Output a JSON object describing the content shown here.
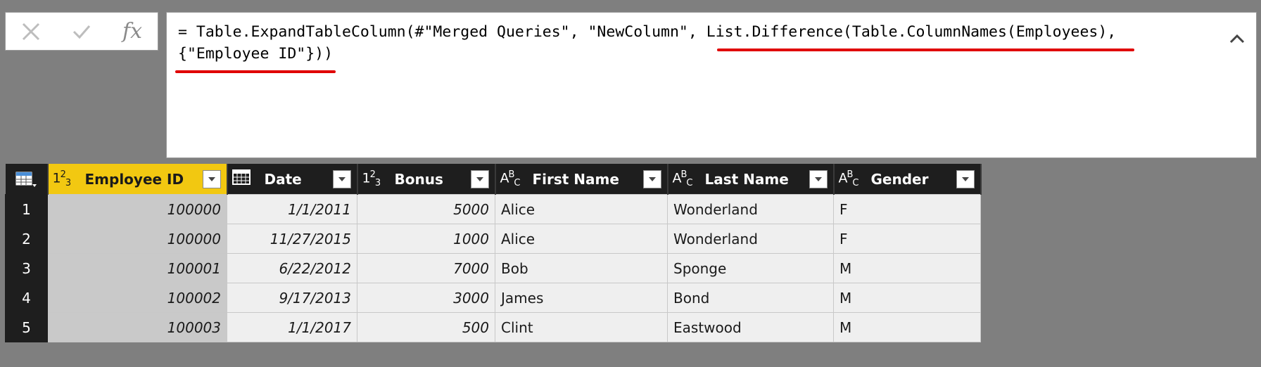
{
  "formula_bar": {
    "cancel_icon": "close-icon",
    "commit_icon": "check-icon",
    "fx_label": "fx",
    "formula_part1": "= Table.ExpandTableColumn(#\"Merged Queries\", \"NewColumn\", ",
    "formula_highlight1": "List.Difference(Table.ColumnNames(Employees),",
    "formula_space": " ",
    "formula_highlight2": "{\"Employee ID\"})",
    "formula_end": ")",
    "underline_color": "#e00000"
  },
  "table": {
    "columns": [
      {
        "type_icon": "123",
        "label": "Employee ID",
        "active": true
      },
      {
        "type_icon": "date",
        "label": "Date"
      },
      {
        "type_icon": "123",
        "label": "Bonus"
      },
      {
        "type_icon": "ABC",
        "label": "First Name"
      },
      {
        "type_icon": "ABC",
        "label": "Last Name"
      },
      {
        "type_icon": "ABC",
        "label": "Gender"
      }
    ],
    "rows": [
      {
        "n": "1",
        "cells": [
          "100000",
          "1/1/2011",
          "5000",
          "Alice",
          "Wonderland",
          "F"
        ]
      },
      {
        "n": "2",
        "cells": [
          "100000",
          "11/27/2015",
          "1000",
          "Alice",
          "Wonderland",
          "F"
        ]
      },
      {
        "n": "3",
        "cells": [
          "100001",
          "6/22/2012",
          "7000",
          "Bob",
          "Sponge",
          "M"
        ]
      },
      {
        "n": "4",
        "cells": [
          "100002",
          "9/17/2013",
          "3000",
          "James",
          "Bond",
          "M"
        ]
      },
      {
        "n": "5",
        "cells": [
          "100003",
          "1/1/2017",
          "500",
          "Clint",
          "Eastwood",
          "M"
        ]
      }
    ],
    "active_column_color": "#f2c811"
  }
}
